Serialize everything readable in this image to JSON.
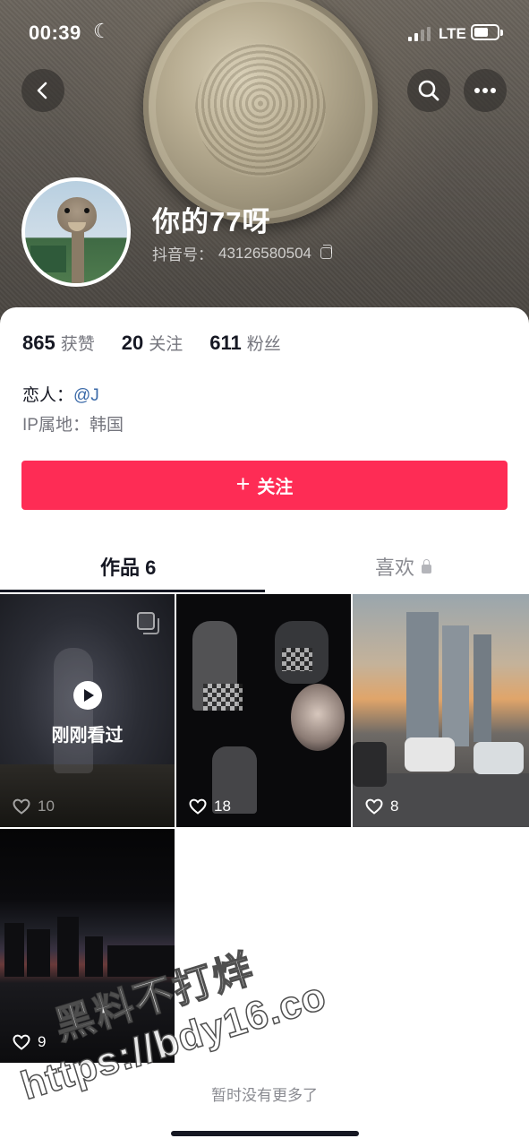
{
  "status_bar": {
    "time": "00:39",
    "network": "LTE"
  },
  "header": {
    "nickname": "你的77呀",
    "douyin_id_label": "抖音号：",
    "douyin_id_value": "43126580504"
  },
  "stats": [
    {
      "value": "865",
      "label": "获赞"
    },
    {
      "value": "20",
      "label": "关注"
    },
    {
      "value": "611",
      "label": "粉丝"
    }
  ],
  "bio": {
    "lover_label": "恋人：",
    "lover_mention": "@J",
    "ip_label": "IP属地：",
    "ip_value": "韩国"
  },
  "follow_button": {
    "plus": "+",
    "label": "关注"
  },
  "tabs": {
    "works": "作品 6",
    "likes": "喜欢"
  },
  "grid": {
    "recent_label": "刚刚看过",
    "items": [
      {
        "likes": "10"
      },
      {
        "likes": "18"
      },
      {
        "likes": "8"
      },
      {
        "likes": "9"
      }
    ]
  },
  "footer": {
    "no_more": "暂时没有更多了"
  },
  "watermark": {
    "line1": "黑料不打烊",
    "line2": "https://bdy16.co"
  },
  "colors": {
    "accent": "#fe2c55",
    "mention": "#3b6aa8",
    "text_primary": "#161823",
    "text_secondary": "#75767e"
  },
  "icons": [
    "moon-icon",
    "back-arrow-icon",
    "search-icon",
    "more-icon",
    "copy-icon",
    "lock-icon",
    "play-icon",
    "heart-icon",
    "multi-image-icon"
  ]
}
